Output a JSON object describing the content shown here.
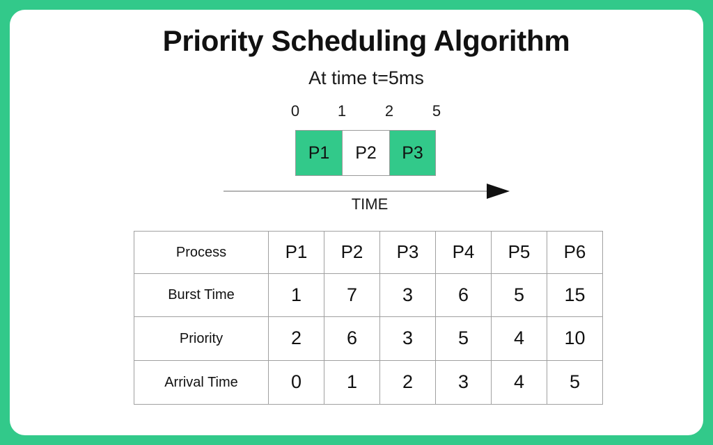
{
  "theme": {
    "frame_color": "#32c98a",
    "bar_green": "#32c98a",
    "bar_white": "#ffffff",
    "text_color": "#111111",
    "grid_color": "#a0a0a0"
  },
  "header": {
    "title": "Priority Scheduling Algorithm",
    "subtitle": "At time t=5ms"
  },
  "gantt": {
    "ticks": [
      "0",
      "1",
      "2",
      "5"
    ],
    "axis_label": "TIME",
    "blocks": [
      {
        "label": "P1",
        "start": 0,
        "end": 1,
        "fill": "green"
      },
      {
        "label": "P2",
        "start": 1,
        "end": 2,
        "fill": "white"
      },
      {
        "label": "P3",
        "start": 2,
        "end": 5,
        "fill": "green"
      }
    ]
  },
  "table": {
    "rows": [
      {
        "header": "Process",
        "values": [
          "P1",
          "P2",
          "P3",
          "P4",
          "P5",
          "P6"
        ]
      },
      {
        "header": "Burst Time",
        "values": [
          "1",
          "7",
          "3",
          "6",
          "5",
          "15"
        ]
      },
      {
        "header": "Priority",
        "values": [
          "2",
          "6",
          "3",
          "5",
          "4",
          "10"
        ]
      },
      {
        "header": "Arrival Time",
        "values": [
          "0",
          "1",
          "2",
          "3",
          "4",
          "5"
        ]
      }
    ]
  },
  "chart_data": {
    "type": "table",
    "title": "Priority Scheduling Algorithm",
    "subtitle": "At time t=5ms",
    "categories": [
      "P1",
      "P2",
      "P3",
      "P4",
      "P5",
      "P6"
    ],
    "series": [
      {
        "name": "Burst Time",
        "values": [
          1,
          7,
          3,
          6,
          5,
          15
        ]
      },
      {
        "name": "Priority",
        "values": [
          2,
          6,
          3,
          5,
          4,
          10
        ]
      },
      {
        "name": "Arrival Time",
        "values": [
          0,
          1,
          2,
          3,
          4,
          5
        ]
      }
    ],
    "gantt": {
      "xlabel": "TIME",
      "tick_values": [
        0,
        1,
        2,
        5
      ],
      "segments": [
        {
          "process": "P1",
          "start": 0,
          "end": 1,
          "highlighted": true
        },
        {
          "process": "P2",
          "start": 1,
          "end": 2,
          "highlighted": false
        },
        {
          "process": "P3",
          "start": 2,
          "end": 5,
          "highlighted": true
        }
      ]
    }
  }
}
